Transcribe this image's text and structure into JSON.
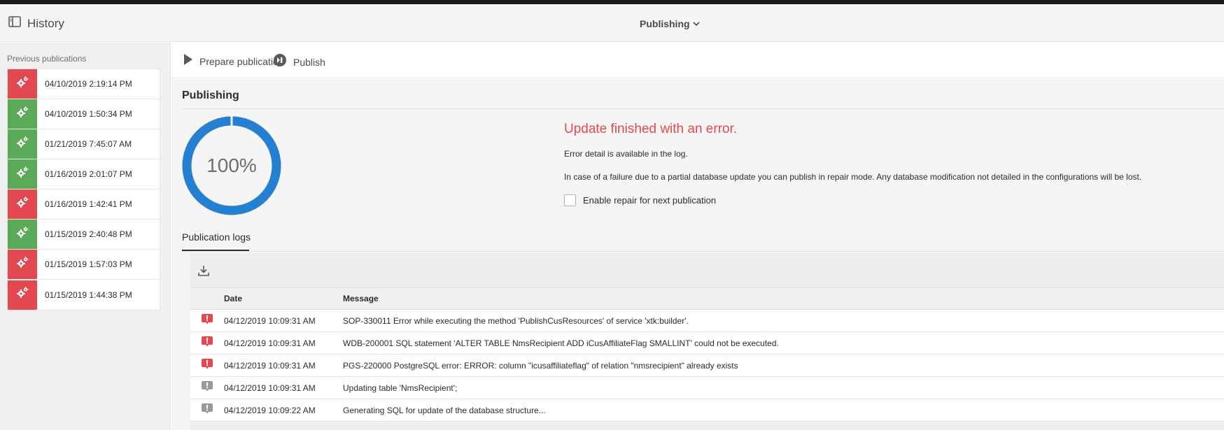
{
  "header": {
    "history_label": "History",
    "center_label": "Publishing"
  },
  "sidebar": {
    "title": "Previous publications",
    "items": [
      {
        "date": "04/10/2019 2:19:14 PM",
        "status": "error"
      },
      {
        "date": "04/10/2019 1:50:34 PM",
        "status": "success"
      },
      {
        "date": "01/21/2019 7:45:07 AM",
        "status": "success"
      },
      {
        "date": "01/16/2019 2:01:07 PM",
        "status": "success"
      },
      {
        "date": "01/16/2019 1:42:41 PM",
        "status": "error"
      },
      {
        "date": "01/15/2019 2:40:48 PM",
        "status": "success"
      },
      {
        "date": "01/15/2019 1:57:03 PM",
        "status": "error"
      },
      {
        "date": "01/15/2019 1:44:38 PM",
        "status": "error"
      }
    ]
  },
  "toolbar": {
    "prepare_label": "Prepare publication",
    "publish_label": "Publish"
  },
  "main": {
    "title": "Publishing",
    "progress": {
      "percent": 100,
      "label": "100%"
    },
    "error_title": "Update finished with an error.",
    "error_detail": "Error detail is available in the log.",
    "failure_text": "In case of a failure due to a partial database update you can publish in repair mode. Any database modification not detailed in the configurations will be lost.",
    "repair_label": "Enable repair for next publication",
    "repair_checked": false
  },
  "logs": {
    "tab_label": "Publication logs",
    "columns": {
      "date": "Date",
      "message": "Message"
    },
    "rows": [
      {
        "level": "error",
        "date": "04/12/2019 10:09:31 AM",
        "message": "SOP-330011 Error while executing the method 'PublishCusResources' of service 'xtk:builder'."
      },
      {
        "level": "error",
        "date": "04/12/2019 10:09:31 AM",
        "message": "WDB-200001 SQL statement 'ALTER TABLE NmsRecipient ADD iCusAffiliateFlag SMALLINT' could not be executed."
      },
      {
        "level": "error",
        "date": "04/12/2019 10:09:31 AM",
        "message": "PGS-220000 PostgreSQL error: ERROR: column \"icusaffiliateflag\" of relation \"nmsrecipient\" already exists"
      },
      {
        "level": "info",
        "date": "04/12/2019 10:09:31 AM",
        "message": "Updating table 'NmsRecipient';"
      },
      {
        "level": "info",
        "date": "04/12/2019 10:09:22 AM",
        "message": "Generating SQL for update of the database structure..."
      }
    ]
  },
  "colors": {
    "error": "#e34850",
    "success": "#5aaa5a",
    "info": "#9a9a9a",
    "progress": "#2680d2"
  }
}
